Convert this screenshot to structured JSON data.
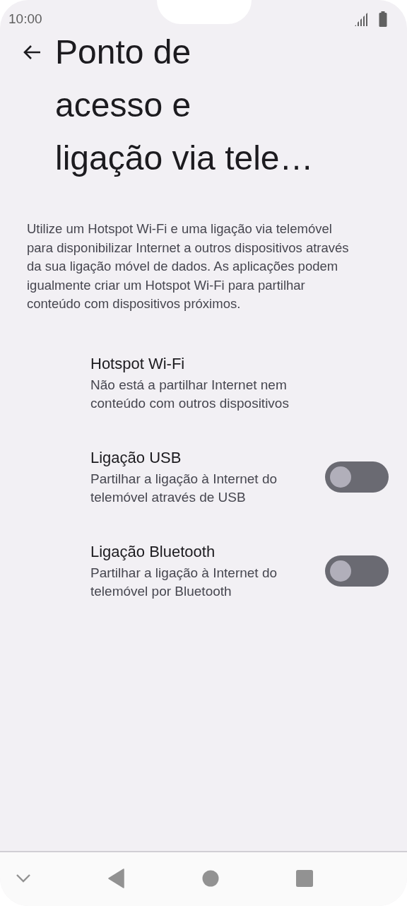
{
  "status_bar": {
    "time": "10:00"
  },
  "header": {
    "title_lines": [
      "Ponto de",
      "acesso e",
      "ligação via tele…"
    ]
  },
  "description": "Utilize um Hotspot Wi-Fi e uma ligação via telemóvel para disponibilizar Internet a outros dispositivos através da sua ligação móvel de dados. As aplicações podem igualmente criar um Hotspot Wi-Fi para partilhar conteúdo com dispositivos próximos.",
  "settings": [
    {
      "kind": "link",
      "title": "Hotspot Wi-Fi",
      "summary": "Não está a partilhar Internet nem conteúdo com outros dispositivos"
    },
    {
      "kind": "switch",
      "title": "Ligação USB",
      "summary": "Partilhar a ligação à Internet do telemóvel através de USB",
      "on": false
    },
    {
      "kind": "switch",
      "title": "Ligação Bluetooth",
      "summary": "Partilhar a ligação à Internet do telemóvel por Bluetooth",
      "on": false
    }
  ]
}
